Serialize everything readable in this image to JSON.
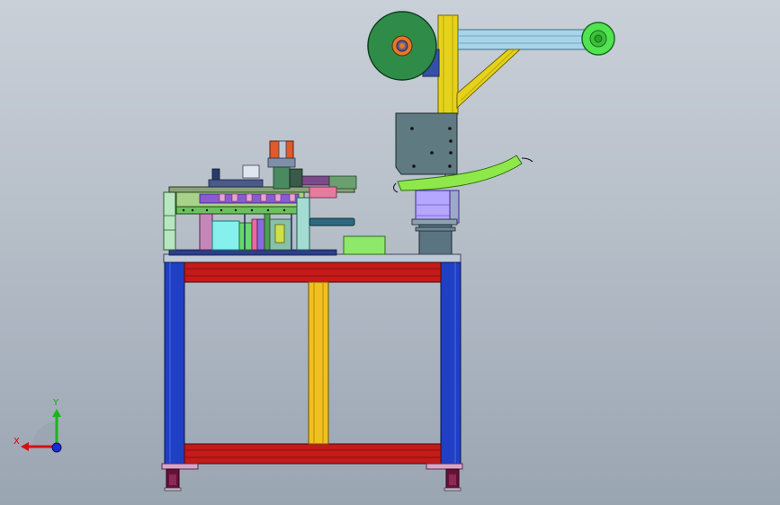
{
  "triad": {
    "x_label": "X",
    "y_label": "Y"
  },
  "colors": {
    "background_top": "#c9d0d8",
    "background_bottom": "#9aa5b2",
    "table_leg": "#1f3fc4",
    "table_beam": "#c41a1a",
    "center_column": "#f0c020",
    "frame_upright": "#e6d21a",
    "reel": "#2f8c48",
    "idler": "#52e352",
    "conveyor_chute": "#8ee84a",
    "mount_plate": "#5f7a80",
    "cylinder": "#b5a6ff",
    "cabinet_base": "#5b7482",
    "tabletop": "#bfc9d8",
    "caster": "#6b0f36"
  }
}
